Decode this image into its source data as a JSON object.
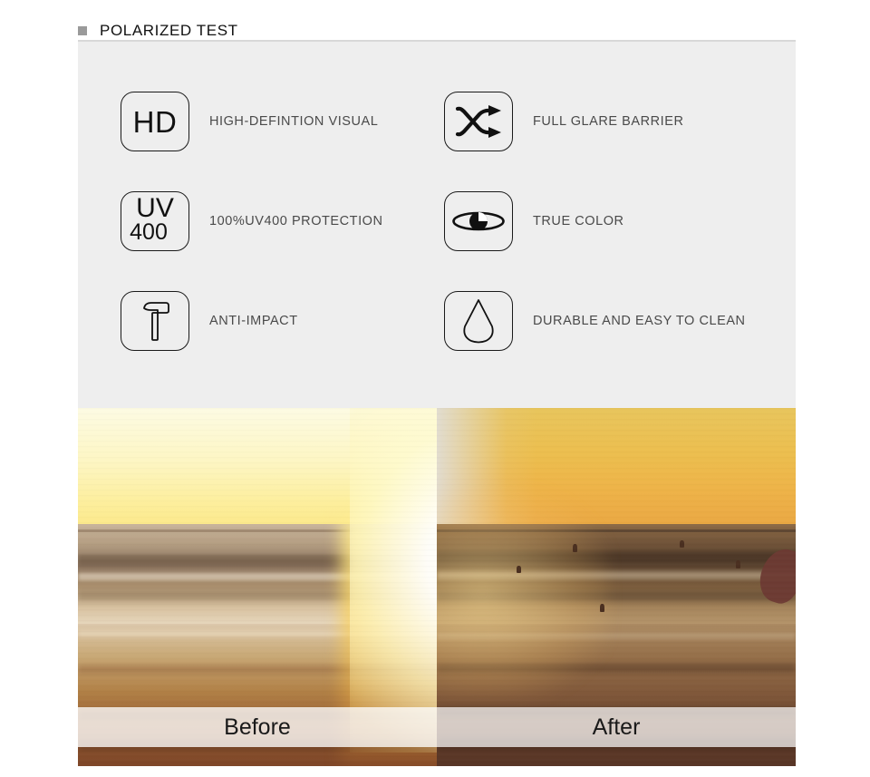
{
  "header": {
    "title": "POLARIZED TEST",
    "bullet_color": "#9a9a9a",
    "rule_color": "#d8d8d8"
  },
  "features": {
    "panel_bg": "#eeeeee",
    "label_color": "#4a4a4a",
    "items": [
      {
        "icon": "hd-text-icon",
        "icon_text": "HD",
        "label": "HIGH-DEFINTION VISUAL"
      },
      {
        "icon": "shuffle-arrows-icon",
        "icon_text": "",
        "label": "FULL GLARE BARRIER"
      },
      {
        "icon": "uv400-text-icon",
        "icon_text": "UV",
        "icon_text2": "400",
        "label": "100%UV400 PROTECTION"
      },
      {
        "icon": "eye-icon",
        "icon_text": "",
        "label": "TRUE COLOR"
      },
      {
        "icon": "hammer-icon",
        "icon_text": "",
        "label": "ANTI-IMPACT"
      },
      {
        "icon": "water-drop-icon",
        "icon_text": "",
        "label": "DURABLE AND EASY TO CLEAN"
      }
    ]
  },
  "comparison": {
    "before_label": "Before",
    "after_label": "After",
    "scene": "beach sunset with ocean waves and surfers"
  }
}
